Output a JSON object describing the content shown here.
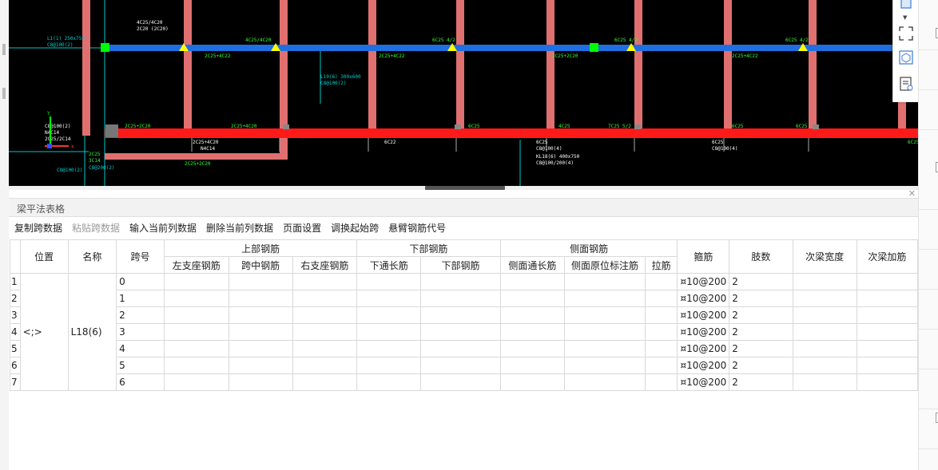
{
  "panel": {
    "title": "梁平法表格",
    "close_icon": "close-icon"
  },
  "toolbar": [
    {
      "label": "复制跨数据",
      "enabled": true
    },
    {
      "label": "粘贴跨数据",
      "enabled": false
    },
    {
      "label": "输入当前列数据",
      "enabled": true
    },
    {
      "label": "删除当前列数据",
      "enabled": true
    },
    {
      "label": "页面设置",
      "enabled": true
    },
    {
      "label": "调换起始跨",
      "enabled": true
    },
    {
      "label": "悬臂钢筋代号",
      "enabled": true
    }
  ],
  "table": {
    "headers": {
      "position": "位置",
      "name": "名称",
      "span": "跨号",
      "top_group": "上部钢筋",
      "bottom_group": "下部钢筋",
      "side_group": "侧面钢筋",
      "top_left": "左支座钢筋",
      "top_mid": "跨中钢筋",
      "top_right": "右支座钢筋",
      "bottom_through": "下通长筋",
      "bottom_bar": "下部钢筋",
      "side_through": "侧面通长筋",
      "side_annot": "侧面原位标注筋",
      "side_tie": "拉筋",
      "stirrup": "箍筋",
      "legs": "肢数",
      "sec_width": "次梁宽度",
      "sec_add": "次梁加筋"
    },
    "position_value": "<;>",
    "name_value": "L18(6)",
    "rows": [
      {
        "num": "1",
        "span": "0",
        "stirrup": "¤10@200",
        "legs": "2"
      },
      {
        "num": "2",
        "span": "1",
        "stirrup": "¤10@200",
        "legs": "2"
      },
      {
        "num": "3",
        "span": "2",
        "stirrup": "¤10@200",
        "legs": "2"
      },
      {
        "num": "4",
        "span": "3",
        "stirrup": "¤10@200",
        "legs": "2"
      },
      {
        "num": "5",
        "span": "4",
        "stirrup": "¤10@200",
        "legs": "2"
      },
      {
        "num": "6",
        "span": "5",
        "stirrup": "¤10@200",
        "legs": "2"
      },
      {
        "num": "7",
        "span": "6",
        "stirrup": "¤10@200",
        "legs": "2"
      }
    ]
  },
  "cad": {
    "colors": {
      "blue_beam": "#1f6fe0",
      "red_beam": "#ff1a1a",
      "column": "#e07070",
      "green_text": "#33ff33",
      "yellow_marker": "#ffff00",
      "cyan_line": "#00c8c8"
    },
    "top_labels": [
      "2C25+2C20",
      "2C25+4C22",
      "4C25 4/2",
      "2C25+2C20",
      "2C25+4C22",
      "6C25 4/2",
      "2C25+2C20"
    ],
    "mid_labels": [
      "6C25",
      "4C25",
      "7C25 5/2",
      "6C25",
      "4C25",
      "6C25"
    ]
  },
  "right_tools": [
    "cube-icon",
    "fullscreen-icon",
    "view-cube-icon",
    "properties-icon"
  ]
}
